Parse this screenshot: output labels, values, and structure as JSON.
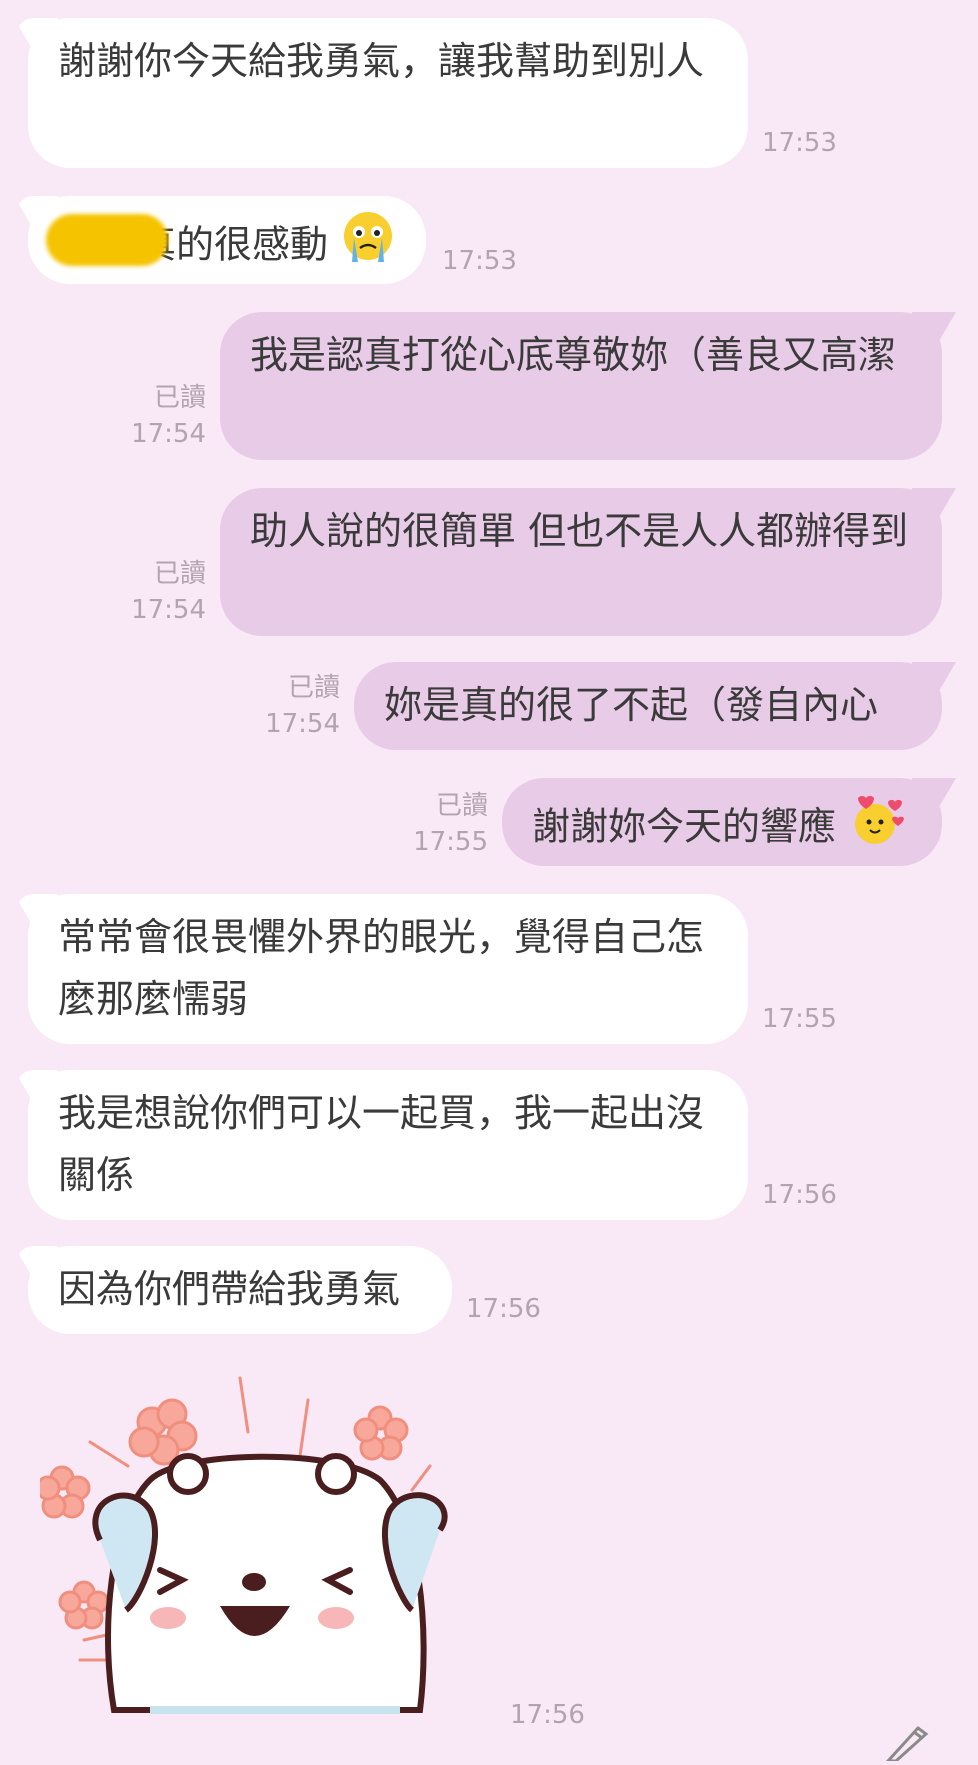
{
  "messages": [
    {
      "dir": "in",
      "text": "謝謝你今天給我勇氣，讓我幫助到別人",
      "time": "17:53"
    },
    {
      "dir": "in",
      "text": "真的很感動",
      "time": "17:53",
      "emoji": "crying-face-emoji"
    },
    {
      "dir": "out",
      "text": "我是認真打從心底尊敬妳（善良又高潔",
      "time": "17:54",
      "read": "已讀"
    },
    {
      "dir": "out",
      "text": "助人說的很簡單 但也不是人人都辦得到",
      "time": "17:54",
      "read": "已讀"
    },
    {
      "dir": "out",
      "text": "妳是真的很了不起（發自內心",
      "time": "17:54",
      "read": "已讀"
    },
    {
      "dir": "out",
      "text": "謝謝妳今天的響應",
      "time": "17:55",
      "read": "已讀",
      "emoji": "heart-face-emoji"
    },
    {
      "dir": "in",
      "text": "常常會很畏懼外界的眼光，覺得自己怎麼那麼懦弱",
      "time": "17:55"
    },
    {
      "dir": "in",
      "text": "我是想說你們可以一起買，我一起出沒關係",
      "time": "17:56"
    },
    {
      "dir": "in",
      "text": "因為你們帶給我勇氣",
      "time": "17:56"
    }
  ],
  "sticker": {
    "icon": "bear-sticker",
    "time": "17:56"
  },
  "colors": {
    "background": "#f9e8f6",
    "incoming": "#ffffff",
    "outgoing": "#e8cbe6",
    "meta": "#b3a3b0"
  }
}
